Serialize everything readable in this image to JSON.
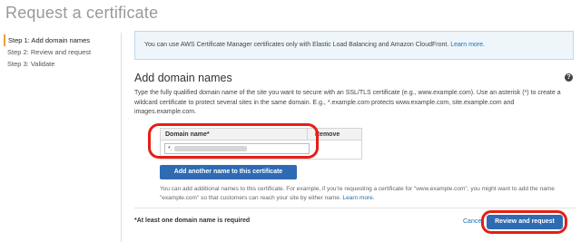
{
  "page": {
    "title": "Request a certificate"
  },
  "steps": [
    {
      "label": "Step 1: Add domain names",
      "active": true
    },
    {
      "label": "Step 2: Review and request",
      "active": false
    },
    {
      "label": "Step 3: Validate",
      "active": false
    }
  ],
  "info": {
    "text": "You can use AWS Certificate Manager certificates only with Elastic Load Balancing and Amazon CloudFront. ",
    "link": "Learn more."
  },
  "section": {
    "title": "Add domain names",
    "help_icon": "question-icon",
    "description": "Type the fully qualified domain name of the site you want to secure with an SSL/TLS certificate (e.g., www.example.com). Use an asterisk (*) to create a wildcard certificate to protect several sites in the same domain. E.g., *.example.com protects www.example.com, site.example.com and images.example.com."
  },
  "domain_table": {
    "col_domain": "Domain name*",
    "col_remove": "Remove",
    "rows": [
      {
        "value_prefix": "*."
      }
    ]
  },
  "add_button": {
    "label": "Add another name to this certificate"
  },
  "add_note": {
    "text": "You can add additional names to this certificate. For example, if you're requesting a certificate for \"www.example.com\", you might want to add the name \"example.com\" so that customers can reach your site by either name. ",
    "link": "Learn more."
  },
  "footer": {
    "required_note": "*At least one domain name is required",
    "cancel_label": "Cancel",
    "review_label": "Review and request"
  },
  "colors": {
    "primary_button": "#2f6bb3",
    "callout": "#e51f14",
    "step_marker": "#f0a030"
  }
}
